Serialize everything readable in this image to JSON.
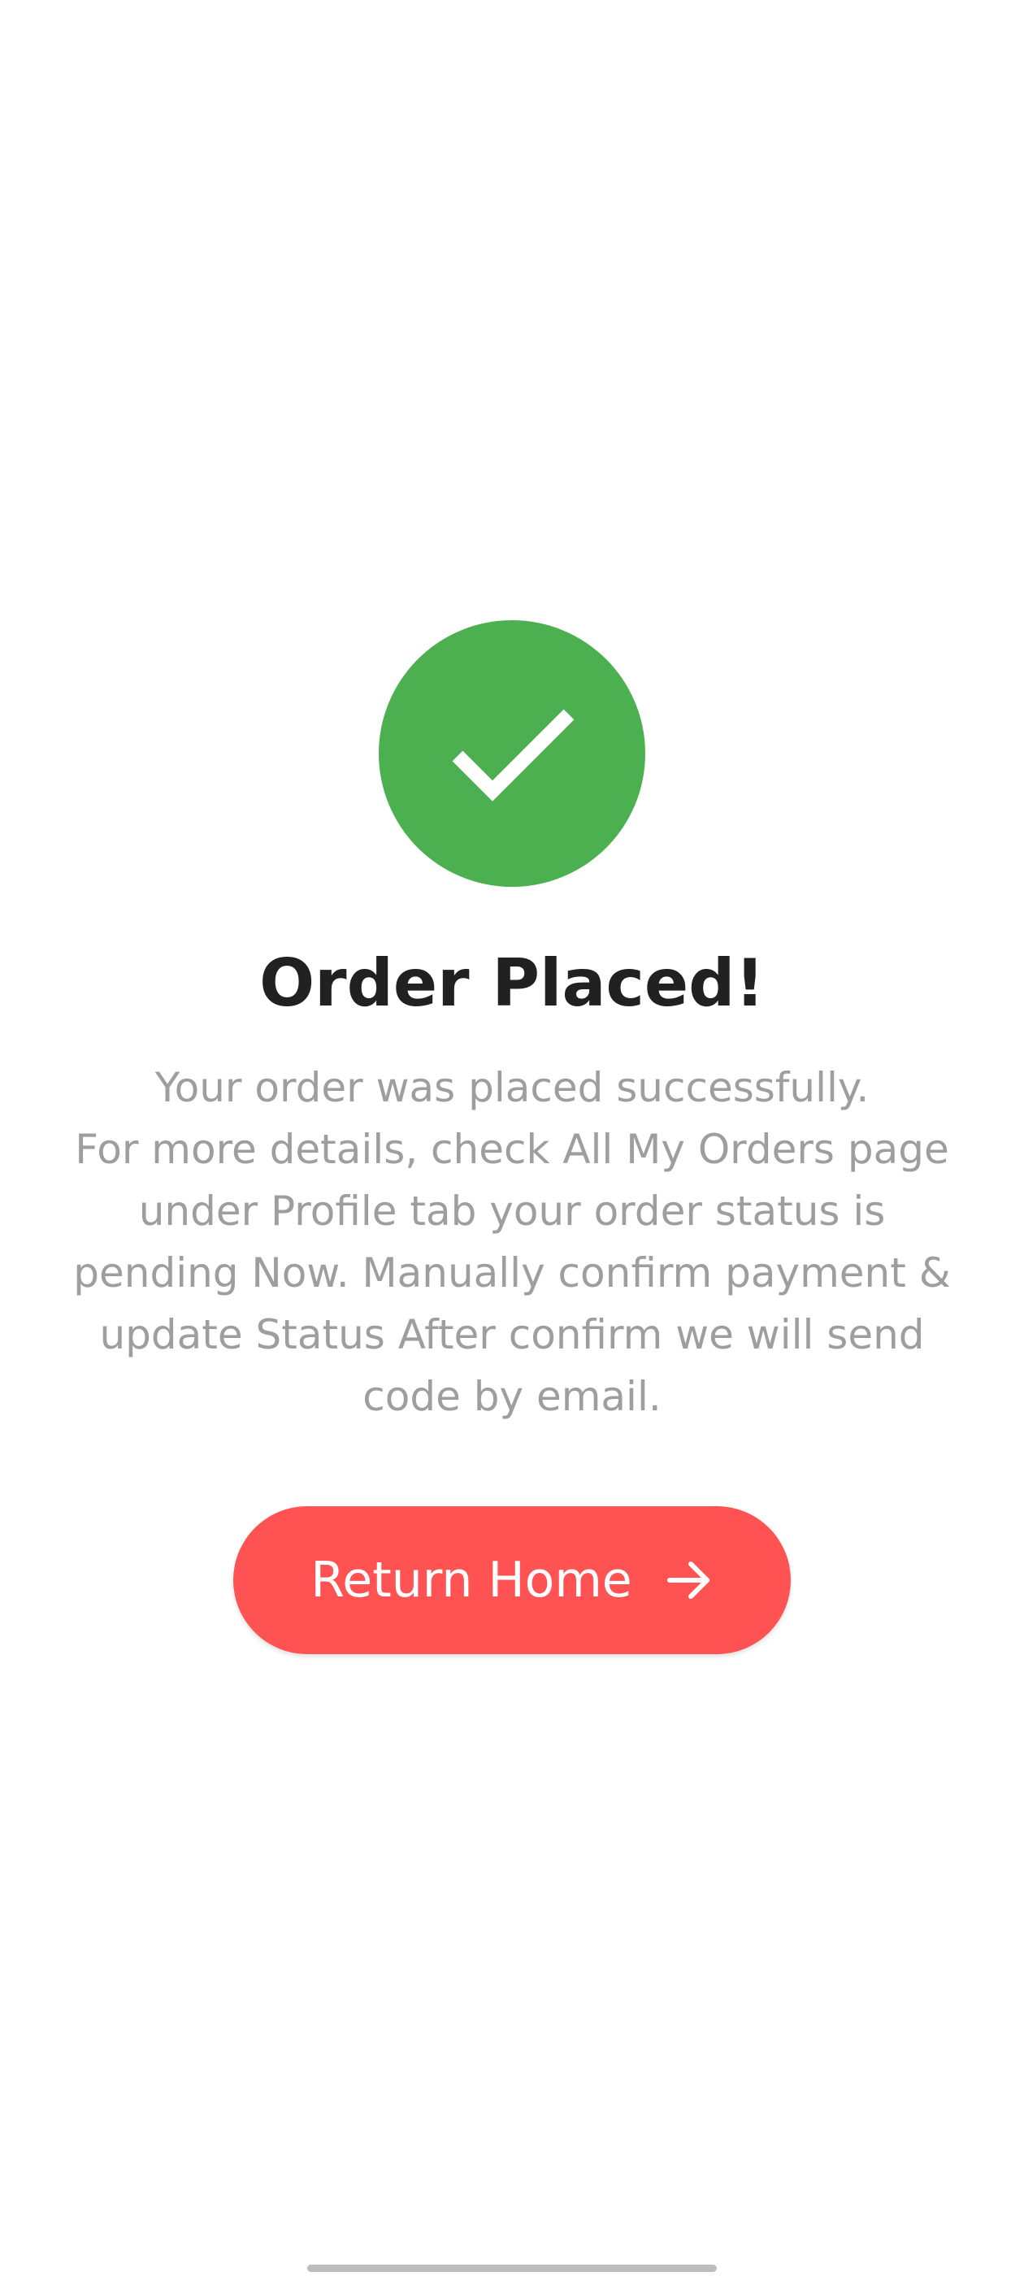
{
  "order_confirmation": {
    "status_icon": "check-icon",
    "title": "Order Placed!",
    "message_lines": [
      "Your order was placed successfully.",
      "For more details, check All My Orders page",
      "under Profile tab your order status is",
      "pending Now. Manually confirm payment &",
      "update Status After confirm we will send",
      "code by email."
    ],
    "return_button": {
      "label": "Return Home",
      "icon": "arrow-right-icon"
    }
  },
  "colors": {
    "success": "#4CAF50",
    "accent": "#FF5252",
    "title_text": "#212121",
    "body_text": "#9E9E9E",
    "background": "#FFFFFF"
  }
}
